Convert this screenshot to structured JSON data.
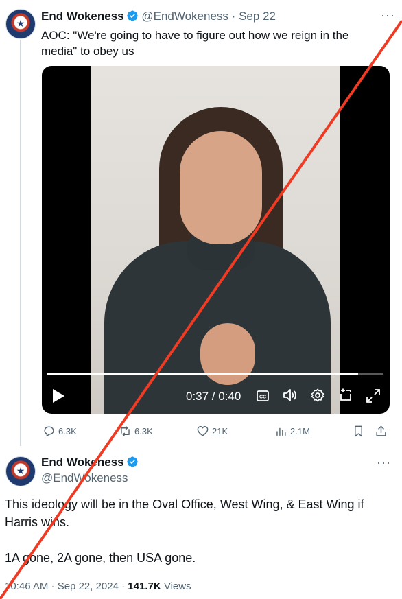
{
  "tweet1": {
    "name": "End Wokeness",
    "handle": "@EndWokeness",
    "separator": "·",
    "date": "Sep 22",
    "text": "AOC: \"We're going to have to figure out how we reign in the media\" to obey us",
    "more": "···",
    "video": {
      "time": "0:37 / 0:40",
      "progress": 0.925,
      "controls": [
        "play-icon",
        "captions-icon",
        "volume-icon",
        "settings-icon",
        "pip-icon",
        "fullscreen-icon"
      ]
    },
    "actions": {
      "replies": "6.3K",
      "reposts": "6.3K",
      "likes": "21K",
      "views": "2.1M"
    }
  },
  "tweet2": {
    "name": "End Wokeness",
    "handle": "@EndWokeness",
    "more": "···",
    "body_line1": "This ideology will be in the Oval Office, West Wing, & East Wing if Harris wins.",
    "body_line2": "1A gone, 2A gone, then USA gone.",
    "time": "10:46 AM · Sep 22, 2024 · ",
    "views_count": "141.7K",
    "views_label": " Views"
  },
  "colors": {
    "verified": "#1d9bf0",
    "muted": "#536471",
    "strike": "#ef3b24"
  }
}
